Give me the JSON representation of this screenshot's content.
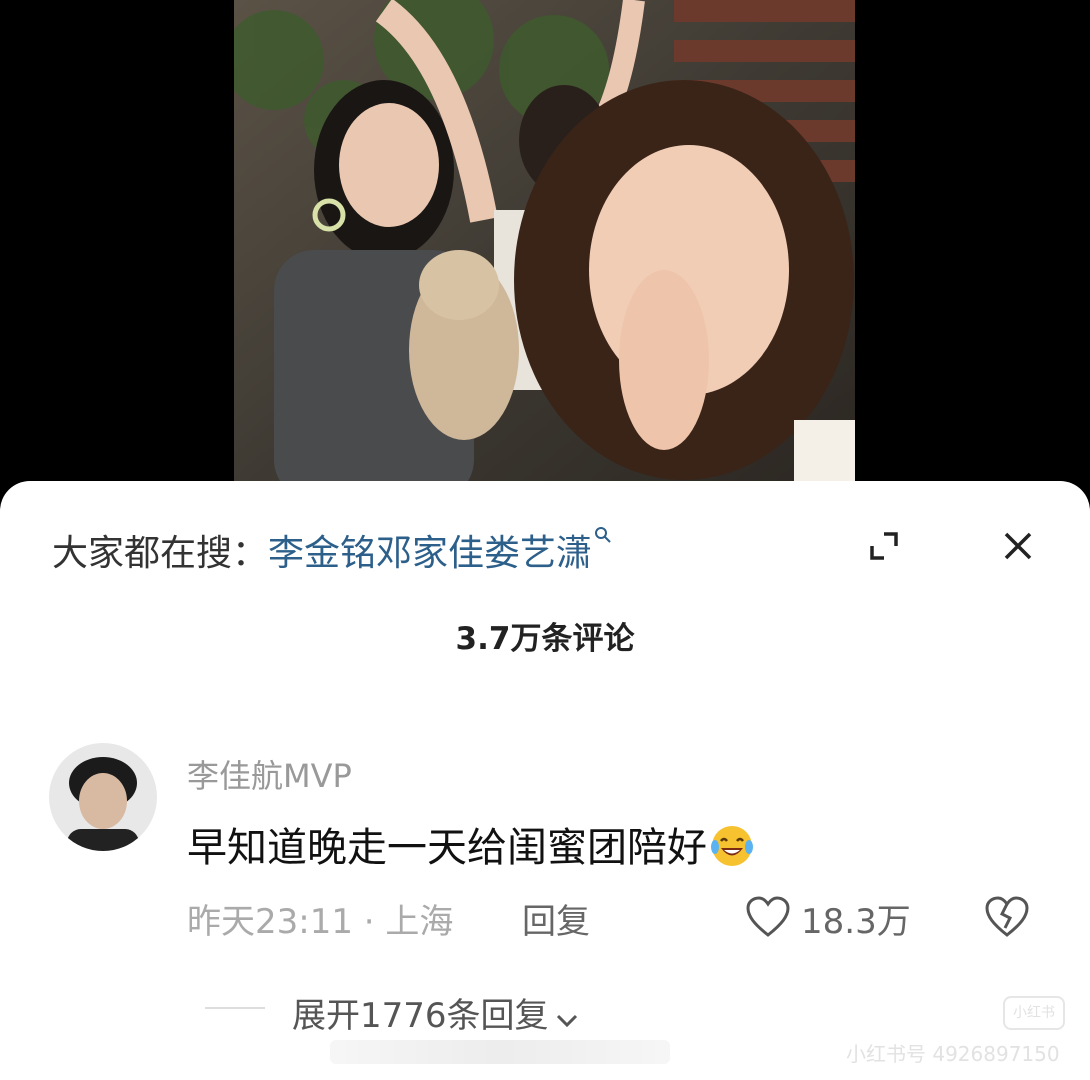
{
  "search_bar": {
    "prefix": "大家都在搜：",
    "term": "李金铭邓家佳娄艺潇"
  },
  "comments_header": {
    "count_label": "3.7万条评论"
  },
  "comment": {
    "username": "李佳航MVP",
    "text": "早知道晚走一天给闺蜜团陪好",
    "timestamp": "昨天23:11",
    "separator": "·",
    "location": "上海",
    "reply_label": "回复",
    "like_count": "18.3万",
    "expand_replies_label": "展开1776条回复"
  },
  "watermark": {
    "text": "小红书号 4926897150",
    "logo_text": "小红书"
  },
  "icons": {
    "search": "search-icon",
    "expand": "expand-icon",
    "close": "close-icon",
    "like": "heart-icon",
    "dislike": "broken-heart-icon",
    "chevron": "chevron-down-icon",
    "emoji": "tears-of-joy-emoji-icon"
  },
  "colors": {
    "search_term": "#2c5f8a",
    "background": "#000000",
    "sheet": "#ffffff"
  }
}
